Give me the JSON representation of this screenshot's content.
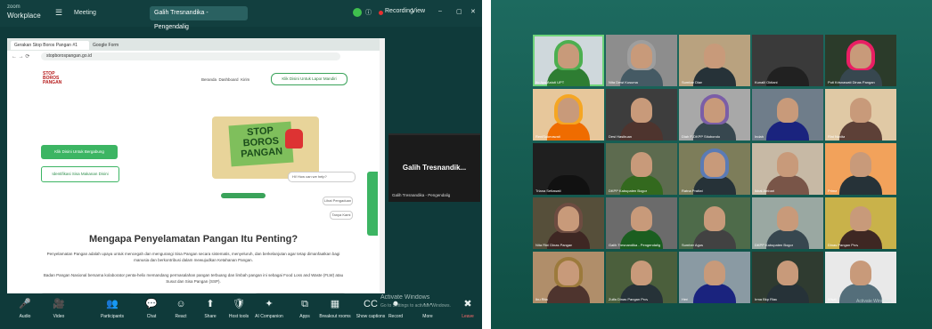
{
  "left": {
    "app": {
      "brand": "zoom",
      "name": "Workplace"
    },
    "tabs": [
      {
        "label": "Meeting"
      },
      {
        "label": "Galih Tresnandika - Pengendalig"
      }
    ],
    "status": {
      "recording": "Recording",
      "view": "View"
    },
    "browser": {
      "tabs": [
        "Gerakan Stop Boros Pangan #1",
        "Google Form"
      ],
      "url": "stopborospangan.go.id",
      "site": {
        "logo": "STOP BOROS PANGAN",
        "nav": [
          "Beranda",
          "Dashboard",
          "Kirim"
        ],
        "cta": "Klik Disini Untuk Lapor Mandiri",
        "primary_button": "Klik Disini Untuk Bergabung",
        "secondary_button": "Identifikasi Sisa Makanan Disini",
        "hero_sign": "STOP BOROS PANGAN",
        "chat_prompt": "Hi! How can we help?",
        "chat_options": [
          "Lihat Pengaduan",
          "Tanya Kami"
        ],
        "heading": "Mengapa Penyelamatan Pangan Itu Penting?",
        "para1": "Penyelamatan Pangan adalah upaya untuk mencegah dan mengurangi Sisa Pangan secara sistematis, menyeluruh, dan berkelanjutan agar tetap dimanfaatkan bagi manusia dan berkontribusi dalam mewujudkan Ketahanan Pangan.",
        "para2": "Badan Pangan Nasional bersama kolaborator penta-helix memandang permasalahan pangan terbuang dan limbah pangan ini sebagai Food Loss and Waste (FLW) atau Susut dan Sisa Pangan (SSP)."
      }
    },
    "self_view": {
      "name": "Galih Tresnandik...",
      "label": "Galih Tresnandika - Pengendalig"
    },
    "toolbar": [
      {
        "icon": "mic-icon",
        "glyph": "🎤",
        "label": "Audio"
      },
      {
        "icon": "video-icon",
        "glyph": "🎥",
        "label": "Video"
      },
      {
        "icon": "participants-icon",
        "glyph": "👥",
        "label": "Participants"
      },
      {
        "icon": "chat-icon",
        "glyph": "💬",
        "label": "Chat"
      },
      {
        "icon": "react-icon",
        "glyph": "☺",
        "label": "React"
      },
      {
        "icon": "share-icon",
        "glyph": "⬆",
        "label": "Share"
      },
      {
        "icon": "host-tools-icon",
        "glyph": "🛡",
        "label": "Host tools"
      },
      {
        "icon": "ai-companion-icon",
        "glyph": "✦",
        "label": "AI Companion"
      },
      {
        "icon": "apps-icon",
        "glyph": "⧉",
        "label": "Apps"
      },
      {
        "icon": "breakout-rooms-icon",
        "glyph": "▦",
        "label": "Breakout rooms"
      },
      {
        "icon": "captions-icon",
        "glyph": "CC",
        "label": "Show captions"
      },
      {
        "icon": "record-icon",
        "glyph": "⏺",
        "label": "Record"
      },
      {
        "icon": "more-icon",
        "glyph": "···",
        "label": "More"
      },
      {
        "icon": "leave-icon",
        "glyph": "✖",
        "label": "Leave"
      }
    ],
    "watermark": {
      "title": "Activate Windows",
      "sub": "Go to Settings to activate Windows."
    }
  },
  "right": {
    "participants": [
      "Ifo Ayu Astuti UPT",
      "Nita Dewi Kusuma",
      "Sumbar Dian",
      "Kunaili Oktiani",
      "Puti Krisnawati Dinas Pangan",
      "ReniSukmawati",
      "Desi Hasibuan",
      "Diah F-DKPP Situbondo",
      "Indah",
      "Rini Novita",
      "Triana Setiawati",
      "DKPP Kabupaten Bogor",
      "Ratna Pratiwi",
      "Ikbal Ambari",
      "Prima",
      "Nita Rini Dinas Pangan",
      "Galih Tresnandika - Pengendalig",
      "Sumber Agus",
      "DKPP Kabupaten Bogor",
      "Dinas Pangan Prov",
      "Ibu Rita",
      "Zulfa Dinas Pangan Prov",
      "Heri",
      "Irma Bkp Riau",
      "Wiwit"
    ],
    "watermark": "Activate Windows"
  }
}
